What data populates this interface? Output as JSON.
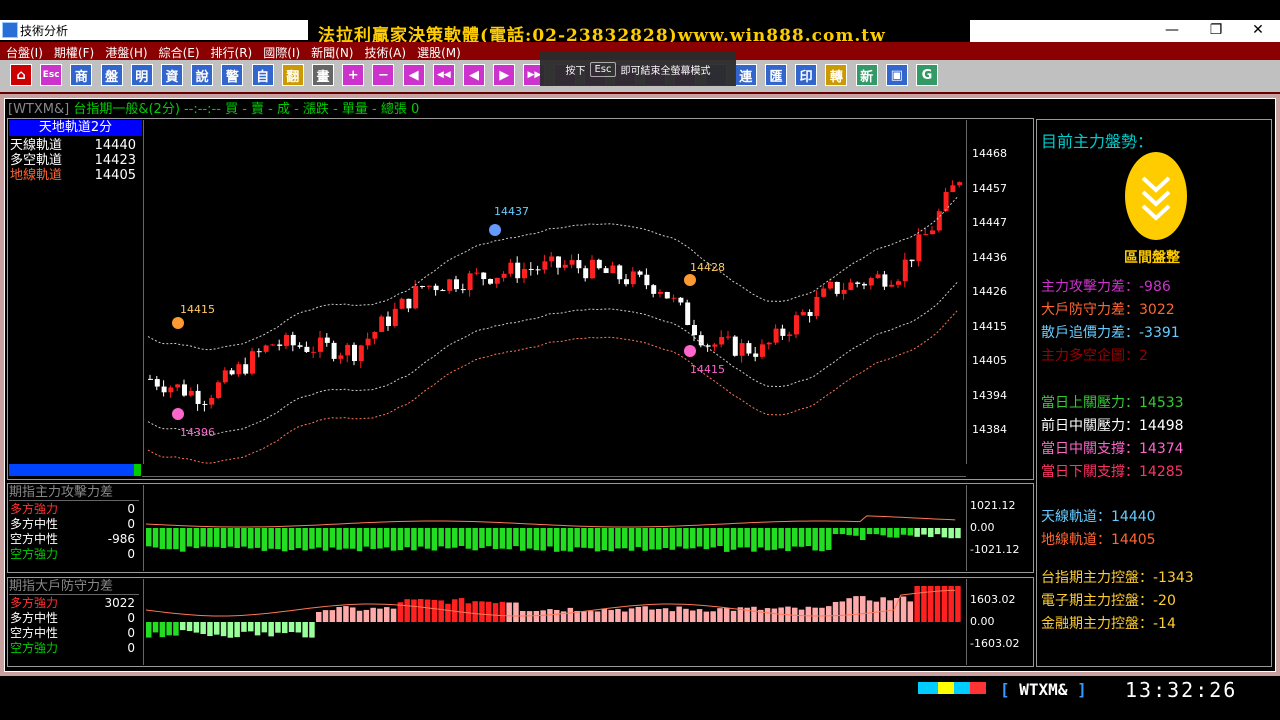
{
  "window": {
    "app_title": "技術分析",
    "brand_banner": "法拉利贏家決策軟體(電話:02-23832828)www.win888.com.tw",
    "min_icon": "minimize-icon",
    "restore_icon": "restore-icon",
    "close_icon": "close-icon"
  },
  "menu": [
    "台盤(I)",
    "期權(F)",
    "港盤(H)",
    "綜合(E)",
    "排行(R)",
    "國際(I)",
    "新聞(N)",
    "技術(A)",
    "選股(M)"
  ],
  "toolbar": {
    "buttons": [
      {
        "label": "⌂",
        "icon": "home-icon",
        "color": "#cc0000"
      },
      {
        "label": "Esc",
        "icon": "esc-icon",
        "color": "#cc33cc"
      },
      {
        "label": "商",
        "icon": "product-icon",
        "color": "#3366cc"
      },
      {
        "label": "盤",
        "icon": "market-icon",
        "color": "#3366cc"
      },
      {
        "label": "明",
        "icon": "detail-icon",
        "color": "#3366cc"
      },
      {
        "label": "資",
        "icon": "data-icon",
        "color": "#3366cc"
      },
      {
        "label": "說",
        "icon": "info-icon",
        "color": "#3366cc"
      },
      {
        "label": "警",
        "icon": "alert-icon",
        "color": "#3366cc"
      },
      {
        "label": "自",
        "icon": "custom-icon",
        "color": "#3366cc"
      },
      {
        "label": "翻",
        "icon": "flip-icon",
        "color": "#cc9900"
      },
      {
        "label": "畫",
        "icon": "draw-icon",
        "color": "#666666"
      },
      {
        "label": "+",
        "icon": "zoom-in-icon",
        "color": "#cc33cc"
      },
      {
        "label": "−",
        "icon": "zoom-out-icon",
        "color": "#cc33cc"
      },
      {
        "label": "◀",
        "icon": "prev-icon",
        "color": "#cc33cc"
      },
      {
        "label": "◀◀",
        "icon": "rewind-icon",
        "color": "#cc33cc"
      },
      {
        "label": "◀",
        "icon": "left-icon",
        "color": "#cc33cc"
      },
      {
        "label": "▶",
        "icon": "right-icon",
        "color": "#cc33cc"
      },
      {
        "label": "▶▶",
        "icon": "forward-icon",
        "color": "#cc33cc"
      },
      {
        "label": "",
        "icon": "blank-icon",
        "color": "#cc33cc"
      },
      {
        "label": "",
        "icon": "blank-icon",
        "color": "#cc33cc"
      },
      {
        "label": "",
        "icon": "blank-icon",
        "color": "#cc33cc"
      },
      {
        "label": "",
        "icon": "blank-icon",
        "color": "#cc33cc"
      },
      {
        "label": "",
        "icon": "blank-icon",
        "color": "#cc33cc"
      },
      {
        "label": "",
        "icon": "blank-icon",
        "color": "#3366cc"
      },
      {
        "label": "連",
        "icon": "link-icon",
        "color": "#3366cc"
      },
      {
        "label": "匯",
        "icon": "export-icon",
        "color": "#3366cc"
      },
      {
        "label": "印",
        "icon": "print-icon",
        "color": "#3366cc"
      },
      {
        "label": "轉",
        "icon": "convert-icon",
        "color": "#cc9900"
      },
      {
        "label": "新",
        "icon": "new-icon",
        "color": "#339966"
      },
      {
        "label": "▣",
        "icon": "window-icon",
        "color": "#3366cc"
      },
      {
        "label": "G",
        "icon": "g-icon",
        "color": "#339966"
      }
    ]
  },
  "esc_tip": {
    "before": "按下",
    "key": "Esc",
    "after": "即可結束全螢幕模式"
  },
  "info_bar": {
    "symbol": "[WTXM&]",
    "text": "台指期一般&(2分)  --:--:-- 買 - 賣 - 成 - 漲跌 - 單量 - 總張 0"
  },
  "legend": {
    "title": "天地軌道2分",
    "rows": [
      {
        "label": "天線軌道",
        "value": "14440",
        "color": "#ffffff"
      },
      {
        "label": "多空軌道",
        "value": "14423",
        "color": "#ffffff"
      },
      {
        "label": "地線軌道",
        "value": "14405",
        "color": "#ff6633"
      }
    ]
  },
  "price_axis": [
    "14468",
    "14457",
    "14447",
    "14436",
    "14426",
    "14415",
    "14405",
    "14394",
    "14384"
  ],
  "annotations": {
    "high": "14437",
    "left_high": "14415",
    "low_left": "14396",
    "mid": "14428",
    "low_mid": "14415"
  },
  "sub1": {
    "title": "期指主力攻擊力差",
    "rows": [
      {
        "label": "多方強力",
        "value": "0",
        "color": "#ff3333"
      },
      {
        "label": "多方中性",
        "value": "0",
        "color": "#ffffff"
      },
      {
        "label": "空方中性",
        "value": "-986",
        "color": "#ffffff"
      },
      {
        "label": "空方強力",
        "value": "0",
        "color": "#00cc00"
      }
    ],
    "axis": [
      "1021.12",
      "0.00",
      "-1021.12"
    ]
  },
  "sub2": {
    "title": "期指大戶防守力差",
    "rows": [
      {
        "label": "多方強力",
        "value": "3022",
        "color": "#ff3333"
      },
      {
        "label": "多方中性",
        "value": "0",
        "color": "#ffffff"
      },
      {
        "label": "空方中性",
        "value": "0",
        "color": "#ffffff"
      },
      {
        "label": "空方強力",
        "value": "0",
        "color": "#00cc00"
      }
    ],
    "axis": [
      "1603.02",
      "0.00",
      "-1603.02"
    ]
  },
  "right_panel": {
    "title": "目前主力盤勢：",
    "badge": "區間盤整",
    "rows": [
      {
        "text": "主力攻擊力差：-986",
        "color": "#cc33cc"
      },
      {
        "text": "大戶防守力差：3022",
        "color": "#ff6633"
      },
      {
        "text": "散戶追價力差：-3391",
        "color": "#66ccff"
      },
      {
        "text": "主力多空企圖：2",
        "color": "#990000"
      },
      {
        "text": "當日上關壓力：14533",
        "color": "#33cc33"
      },
      {
        "text": "前日中關壓力：14498",
        "color": "#ffffff"
      },
      {
        "text": "當日中關支撐：14374",
        "color": "#ff66cc"
      },
      {
        "text": "當日下關支撐：14285",
        "color": "#ff3366"
      },
      {
        "text": "天線軌道：14440",
        "color": "#66ccff"
      },
      {
        "text": "地線軌道：14405",
        "color": "#ff6633"
      },
      {
        "text": "台指期主力控盤：-1343",
        "color": "#ffcc33"
      },
      {
        "text": "電子期主力控盤：-20",
        "color": "#ffcc33"
      },
      {
        "text": "金融期主力控盤：-14",
        "color": "#ffcc33"
      }
    ]
  },
  "status": {
    "symbol": "WTXM&",
    "time": "13:32:26"
  }
}
